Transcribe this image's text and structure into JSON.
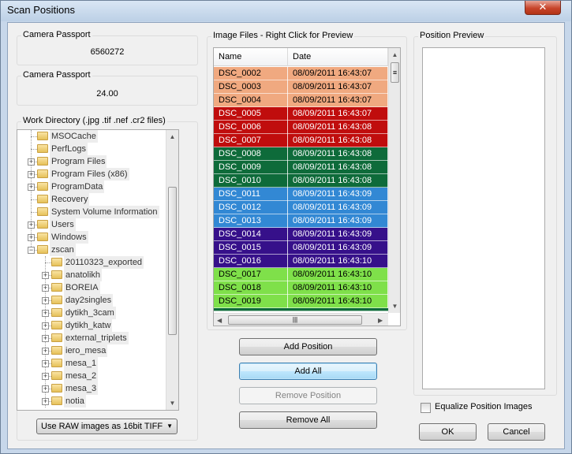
{
  "window": {
    "title": "Scan Positions",
    "close_glyph": "✕"
  },
  "camera_passport_1": {
    "label": "Camera Passport",
    "value": "6560272"
  },
  "camera_passport_2": {
    "label": "Camera Passport",
    "value": "24.00"
  },
  "work_directory": {
    "label": "Work Directory (.jpg .tif .nef .cr2 files)",
    "items": [
      {
        "label": "MSOCache",
        "level": 0,
        "expandable": false
      },
      {
        "label": "PerfLogs",
        "level": 0,
        "expandable": false
      },
      {
        "label": "Program Files",
        "level": 0,
        "expandable": true
      },
      {
        "label": "Program Files (x86)",
        "level": 0,
        "expandable": true
      },
      {
        "label": "ProgramData",
        "level": 0,
        "expandable": true
      },
      {
        "label": "Recovery",
        "level": 0,
        "expandable": false
      },
      {
        "label": "System Volume Information",
        "level": 0,
        "expandable": false
      },
      {
        "label": "Users",
        "level": 0,
        "expandable": true
      },
      {
        "label": "Windows",
        "level": 0,
        "expandable": true
      },
      {
        "label": "zscan",
        "level": 0,
        "expandable": true,
        "expanded": true
      },
      {
        "label": "20110323_exported",
        "level": 1,
        "expandable": false
      },
      {
        "label": "anatolikh",
        "level": 1,
        "expandable": true
      },
      {
        "label": "BOREIA",
        "level": 1,
        "expandable": true
      },
      {
        "label": "day2singles",
        "level": 1,
        "expandable": true
      },
      {
        "label": "dytikh_3cam",
        "level": 1,
        "expandable": true
      },
      {
        "label": "dytikh_katw",
        "level": 1,
        "expandable": true
      },
      {
        "label": "external_triplets",
        "level": 1,
        "expandable": true
      },
      {
        "label": "iero_mesa",
        "level": 1,
        "expandable": true
      },
      {
        "label": "mesa_1",
        "level": 1,
        "expandable": true
      },
      {
        "label": "mesa_2",
        "level": 1,
        "expandable": true
      },
      {
        "label": "mesa_3",
        "level": 1,
        "expandable": true
      },
      {
        "label": "notia",
        "level": 1,
        "expandable": true
      }
    ]
  },
  "raw_select": {
    "value": "Use RAW images as 16bit TIFF"
  },
  "image_files": {
    "label": "Image Files - Right Click for Preview",
    "columns": [
      "Name",
      "Date"
    ],
    "rows": [
      {
        "name": "DSC_0002",
        "date": "08/09/2011 16:43:07",
        "bg": "#f0a980",
        "fg": "#000000"
      },
      {
        "name": "DSC_0003",
        "date": "08/09/2011 16:43:07",
        "bg": "#f0a980",
        "fg": "#000000"
      },
      {
        "name": "DSC_0004",
        "date": "08/09/2011 16:43:07",
        "bg": "#f0a980",
        "fg": "#000000"
      },
      {
        "name": "DSC_0005",
        "date": "08/09/2011 16:43:07",
        "bg": "#c00d0d",
        "fg": "#ffffff"
      },
      {
        "name": "DSC_0006",
        "date": "08/09/2011 16:43:08",
        "bg": "#c00d0d",
        "fg": "#ffffff"
      },
      {
        "name": "DSC_0007",
        "date": "08/09/2011 16:43:08",
        "bg": "#c00d0d",
        "fg": "#ffffff"
      },
      {
        "name": "DSC_0008",
        "date": "08/09/2011 16:43:08",
        "bg": "#0e6b3a",
        "fg": "#ffffff"
      },
      {
        "name": "DSC_0009",
        "date": "08/09/2011 16:43:08",
        "bg": "#0e6b3a",
        "fg": "#ffffff"
      },
      {
        "name": "DSC_0010",
        "date": "08/09/2011 16:43:08",
        "bg": "#0e6b3a",
        "fg": "#ffffff"
      },
      {
        "name": "DSC_0011",
        "date": "08/09/2011 16:43:09",
        "bg": "#3288d4",
        "fg": "#ffffff"
      },
      {
        "name": "DSC_0012",
        "date": "08/09/2011 16:43:09",
        "bg": "#3288d4",
        "fg": "#ffffff"
      },
      {
        "name": "DSC_0013",
        "date": "08/09/2011 16:43:09",
        "bg": "#3288d4",
        "fg": "#ffffff"
      },
      {
        "name": "DSC_0014",
        "date": "08/09/2011 16:43:09",
        "bg": "#36108a",
        "fg": "#ffffff"
      },
      {
        "name": "DSC_0015",
        "date": "08/09/2011 16:43:09",
        "bg": "#36108a",
        "fg": "#ffffff"
      },
      {
        "name": "DSC_0016",
        "date": "08/09/2011 16:43:10",
        "bg": "#36108a",
        "fg": "#ffffff"
      },
      {
        "name": "DSC_0017",
        "date": "08/09/2011 16:43:10",
        "bg": "#7fe04a",
        "fg": "#000000"
      },
      {
        "name": "DSC_0018",
        "date": "08/09/2011 16:43:10",
        "bg": "#7fe04a",
        "fg": "#000000"
      },
      {
        "name": "DSC_0019",
        "date": "08/09/2011 16:43:10",
        "bg": "#7fe04a",
        "fg": "#000000"
      }
    ]
  },
  "buttons": {
    "add_position": "Add Position",
    "add_all": "Add All",
    "remove_position": "Remove Position",
    "remove_all": "Remove All",
    "ok": "OK",
    "cancel": "Cancel"
  },
  "position_preview": {
    "label": "Position Preview"
  },
  "equalize": {
    "label": "Equalize Position Images",
    "checked": false
  },
  "icons": {
    "scroll_up": "▲",
    "scroll_down": "▼",
    "scroll_left": "◀",
    "scroll_right": "▶",
    "grip": "≡",
    "combo_arrow": "▼"
  }
}
